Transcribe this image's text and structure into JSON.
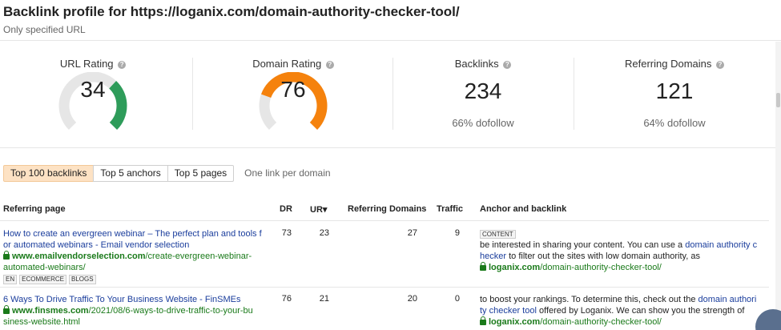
{
  "header": {
    "title": "Backlink profile for https://loganix.com/domain-authority-checker-tool/",
    "subtitle": "Only specified URL"
  },
  "metrics": {
    "url_rating": {
      "label": "URL Rating",
      "value": "34",
      "fraction": 0.34,
      "color": "#2e9c5a"
    },
    "domain_rating": {
      "label": "Domain Rating",
      "value": "76",
      "fraction": 0.76,
      "color": "#f5820d"
    },
    "backlinks": {
      "label": "Backlinks",
      "value": "234",
      "sub": "66% dofollow"
    },
    "referring_domains": {
      "label": "Referring Domains",
      "value": "121",
      "sub": "64% dofollow"
    },
    "help_glyph": "?"
  },
  "tabs": [
    {
      "label": "Top 100 backlinks",
      "active": true
    },
    {
      "label": "Top 5 anchors",
      "active": false
    },
    {
      "label": "Top 5 pages",
      "active": false
    }
  ],
  "tab_note": "One link per domain",
  "table": {
    "columns": {
      "referring_page": "Referring page",
      "dr": "DR",
      "ur": "UR",
      "ur_sort": "▾",
      "referring_domains": "Referring Domains",
      "traffic": "Traffic",
      "anchor": "Anchor and backlink"
    },
    "rows": [
      {
        "title_l1": "How to create an evergreen webinar – The perfect plan and tools f",
        "title_l2": "or automated webinars - Email vendor selection",
        "url_domain": "www.emailvendorselection.com",
        "url_path_l1": "/create-evergreen-webinar-",
        "url_path_l2": "automated-webinars/",
        "tags": [
          "EN",
          "ECOMMERCE",
          "BLOGS"
        ],
        "dr": "73",
        "ur": "23",
        "referring_domains": "27",
        "traffic": "9",
        "anchor_badge": "CONTENT",
        "anchor_pre": "be interested in sharing your content. You can use a ",
        "anchor_link_l1": "domain authority c",
        "anchor_link_l2": "hecker",
        "anchor_post": " to filter out the sites with low domain authority, as",
        "backlink_domain": "loganix.com",
        "backlink_path": "/domain-authority-checker-tool/"
      },
      {
        "title_l1": "6 Ways To Drive Traffic To Your Business Website - FinSMEs",
        "url_domain": "www.finsmes.com",
        "url_path_l1": "/2021/08/6-ways-to-drive-traffic-to-your-bu",
        "url_path_l2": "siness-website.html",
        "dr": "76",
        "ur": "21",
        "referring_domains": "20",
        "traffic": "0",
        "anchor_pre": "to boost your rankings. To determine this, check out the ",
        "anchor_link_l1": "domain authori",
        "anchor_link_l2": "ty checker tool",
        "anchor_post": " offered by Loganix. We can show you the strength of",
        "backlink_domain": "loganix.com",
        "backlink_path": "/domain-authority-checker-tool/"
      }
    ]
  }
}
